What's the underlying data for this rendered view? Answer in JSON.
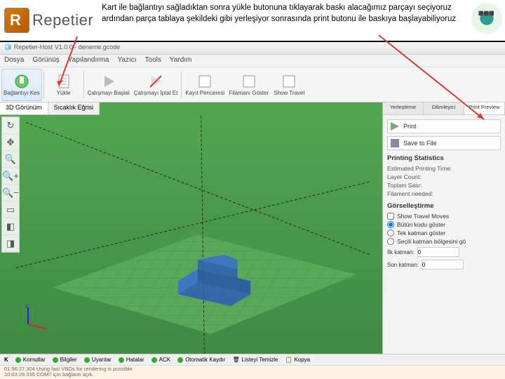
{
  "banner": {
    "logo_text": "Repetier",
    "instruction": "Kart ile bağlantıyı sağladıktan sonra yükle butonuna tıklayarak baskı alacağımız parçayı seçiyoruz ardından parça tablaya şekildeki gibi yerleşiyor sonrasında print butonu ile baskıya başlayabiliyoruz"
  },
  "window": {
    "title": "Repetier-Host V1.0.0 - deneme.gcode"
  },
  "menu": {
    "items": [
      "Dosya",
      "Görünüş",
      "Yapılandırma",
      "Yazıcı",
      "Tools",
      "Yardım"
    ]
  },
  "toolbar": {
    "connect": "Bağlantıyı Kes",
    "load": "Yükle",
    "start": "Çalışmayı Başlat",
    "kill": "Çalışmayı İptal Et",
    "log": "Kayıt Penceresi",
    "filament": "Filamanı Göster",
    "travel": "Show Travel"
  },
  "view_tabs": {
    "t1": "3D Görünüm",
    "t2": "Sıcaklık Eğrisi"
  },
  "left_tools": [
    "↻",
    "✥",
    "🔍",
    "🔍+",
    "🔍−",
    "▭",
    "◧",
    "◨"
  ],
  "right": {
    "tabs": [
      "Yerleştirme",
      "Dilimleyici",
      "Print Preview"
    ],
    "print": "Print",
    "save": "Save to File",
    "stats_title": "Printing Statistics",
    "stats": [
      "Estimated Printing Time:",
      "Layer Count:",
      "Toplam Satır:",
      "Filament needed:"
    ],
    "viz_title": "Görselleştirme",
    "opts": [
      "Show Travel Moves",
      "Bütün kodu göster",
      "Tek katman göster",
      "Seçili katman bölgesini gö"
    ],
    "ilk": "İlk katman:",
    "son": "Son katman:",
    "ilk_v": "0",
    "son_v": "0"
  },
  "status": {
    "items": [
      {
        "c": "#3a3",
        "t": "Komutlar"
      },
      {
        "c": "#3a3",
        "t": "Bilgiler"
      },
      {
        "c": "#3a3",
        "t": "Uyarılar"
      },
      {
        "c": "#3a3",
        "t": "Hatalar"
      },
      {
        "c": "#3a3",
        "t": "ACK"
      },
      {
        "c": "#3a3",
        "t": "Otomatik Kaydır"
      },
      {
        "c": "#888",
        "t": "Listeyi Temizle"
      },
      {
        "c": "#888",
        "t": "Kopya"
      }
    ],
    "log1": "01:56:27.304  Using fast VBOs for rendering is possible",
    "log2": "10:03:29.335  COM7 için bağlantı açık."
  }
}
